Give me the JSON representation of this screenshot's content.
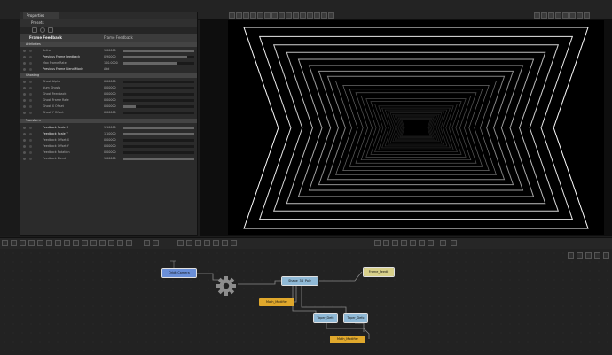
{
  "properties": {
    "tab_label": "Properties",
    "presets_label": "Presets",
    "node_title": "Frame Feedback",
    "node_type": "Frame Feedback"
  },
  "sections": [
    {
      "name": "Attributes",
      "rows": [
        {
          "label": "Active",
          "value": "1.00000",
          "fill": 1.0
        },
        {
          "label": "Previous Frame Feedback",
          "value": "0.90000",
          "fill": 0.9
        },
        {
          "label": "Max Frame Rate",
          "value": "100.0000",
          "fill": 0.75
        },
        {
          "label": "Previous Frame Blend Mode",
          "value": "Add",
          "fill": null
        }
      ]
    },
    {
      "name": "Ghosting",
      "rows": [
        {
          "label": "Ghost Alpha",
          "value": "0.00000",
          "fill": null
        },
        {
          "label": "Num Ghosts",
          "value": "0.00000",
          "fill": null
        },
        {
          "label": "Ghost Feedback",
          "value": "0.00000",
          "fill": null
        },
        {
          "label": "Ghost Frame Rate",
          "value": "0.00000",
          "fill": null
        },
        {
          "label": "Ghost X Offset",
          "value": "0.00000",
          "fill": 0.18
        },
        {
          "label": "Ghost Y Offset",
          "value": "0.00000",
          "fill": null
        }
      ]
    },
    {
      "name": "Transform",
      "rows": [
        {
          "label": "Feedback Scale X",
          "value": "1.10000",
          "fill": 1.0
        },
        {
          "label": "Feedback Scale Y",
          "value": "1.10000",
          "fill": 1.0
        },
        {
          "label": "Feedback Offset X",
          "value": "0.00000",
          "fill": null
        },
        {
          "label": "Feedback Offset Y",
          "value": "0.00000",
          "fill": null
        },
        {
          "label": "Feedback Rotation",
          "value": "0.00000",
          "fill": null
        },
        {
          "label": "Feedback Blend",
          "value": "1.00000",
          "fill": 1.0
        }
      ]
    }
  ],
  "nodes": {
    "camera": "Orbit_Camera",
    "shape": "Shape_3D_Poly",
    "math1": "Math_Modifier",
    "taper1": "Taper_Defo",
    "taper2": "Taper_Defo",
    "math2": "Math_Modifier",
    "frame": "Frame_Feedb"
  },
  "colors": {
    "camera_node": "#6a8fd8",
    "shape_node": "#8fb9d6",
    "math_node": "#e0a82c",
    "frame_node": "#d8d08a"
  }
}
